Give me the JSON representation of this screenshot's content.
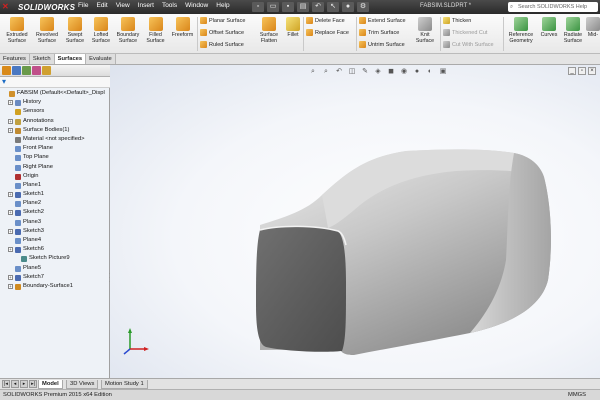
{
  "app": {
    "logo_text": "SOLIDWORKS",
    "menus": [
      "File",
      "Edit",
      "View",
      "Insert",
      "Tools",
      "Window",
      "Help"
    ],
    "document_title": "FABSIM.SLDPRT *",
    "help_search_placeholder": "Search SOLIDWORKS Help"
  },
  "ribbon": {
    "big_buttons": [
      {
        "label_l1": "Extruded",
        "label_l2": "Surface",
        "icon": "extruded-surface-icon"
      },
      {
        "label_l1": "Revolved",
        "label_l2": "Surface",
        "icon": "revolved-surface-icon"
      },
      {
        "label_l1": "Swept",
        "label_l2": "Surface",
        "icon": "swept-surface-icon"
      },
      {
        "label_l1": "Lofted",
        "label_l2": "Surface",
        "icon": "lofted-surface-icon"
      },
      {
        "label_l1": "Boundary",
        "label_l2": "Surface",
        "icon": "boundary-surface-icon"
      },
      {
        "label_l1": "Filled",
        "label_l2": "Surface",
        "icon": "filled-surface-icon"
      },
      {
        "label_l1": "Freeform",
        "label_l2": "",
        "icon": "freeform-icon"
      }
    ],
    "group1": [
      "Planar Surface",
      "Offset Surface",
      "Ruled Surface"
    ],
    "surface_flatten": {
      "label_l1": "Surface",
      "label_l2": "Flatten"
    },
    "fillet": "Fillet",
    "group2": [
      "Delete Face",
      "Replace Face"
    ],
    "group3": [
      "Extend Surface",
      "Trim Surface",
      "Untrim Surface"
    ],
    "knit": {
      "label_l1": "Knit",
      "label_l2": "Surface"
    },
    "group4": [
      "Thicken",
      "Thickened Cut",
      "Cut With Surface"
    ],
    "reference_geometry": {
      "label_l1": "Reference",
      "label_l2": "Geometry"
    },
    "curves": "Curves",
    "radiate": {
      "label_l1": "Radiate",
      "label_l2": "Surface"
    },
    "mid": "Mid-"
  },
  "command_tabs": [
    {
      "label": "Features",
      "active": false
    },
    {
      "label": "Sketch",
      "active": false
    },
    {
      "label": "Surfaces",
      "active": true
    },
    {
      "label": "Evaluate",
      "active": false
    }
  ],
  "feature_tree": [
    {
      "label": "FABSIM  (Default<<Default>_Displ",
      "indent": 0,
      "icon": "part-icon",
      "exp": false
    },
    {
      "label": "History",
      "indent": 1,
      "icon": "history-icon",
      "exp": true
    },
    {
      "label": "Sensors",
      "indent": 1,
      "icon": "sensors-icon",
      "exp": false
    },
    {
      "label": "Annotations",
      "indent": 1,
      "icon": "annotations-icon",
      "exp": true
    },
    {
      "label": "Surface Bodies(1)",
      "indent": 1,
      "icon": "surface-bodies-icon",
      "exp": true
    },
    {
      "label": "Material <not specified>",
      "indent": 1,
      "icon": "material-icon",
      "exp": false
    },
    {
      "label": "Front Plane",
      "indent": 1,
      "icon": "plane-icon",
      "exp": false
    },
    {
      "label": "Top Plane",
      "indent": 1,
      "icon": "plane-icon",
      "exp": false
    },
    {
      "label": "Right Plane",
      "indent": 1,
      "icon": "plane-icon",
      "exp": false
    },
    {
      "label": "Origin",
      "indent": 1,
      "icon": "origin-icon",
      "exp": false
    },
    {
      "label": "Plane1",
      "indent": 1,
      "icon": "plane-icon",
      "exp": false
    },
    {
      "label": "Sketch1",
      "indent": 1,
      "icon": "sketch-icon",
      "exp": true
    },
    {
      "label": "Plane2",
      "indent": 1,
      "icon": "plane-icon",
      "exp": false
    },
    {
      "label": "Sketch2",
      "indent": 1,
      "icon": "sketch-icon",
      "exp": true
    },
    {
      "label": "Plane3",
      "indent": 1,
      "icon": "plane-icon",
      "exp": false
    },
    {
      "label": "Sketch3",
      "indent": 1,
      "icon": "sketch-icon",
      "exp": true
    },
    {
      "label": "Plane4",
      "indent": 1,
      "icon": "plane-icon",
      "exp": false
    },
    {
      "label": "Sketch6",
      "indent": 1,
      "icon": "sketch-icon",
      "exp": true
    },
    {
      "label": "Sketch Picture9",
      "indent": 2,
      "icon": "sketch-picture-icon",
      "exp": false
    },
    {
      "label": "Plane5",
      "indent": 1,
      "icon": "plane-icon",
      "exp": false
    },
    {
      "label": "Sketch7",
      "indent": 1,
      "icon": "sketch-icon",
      "exp": true
    },
    {
      "label": "Boundary-Surface1",
      "indent": 1,
      "icon": "boundary-surface-icon",
      "exp": true
    }
  ],
  "model_tabs": [
    {
      "label": "Model",
      "active": true
    },
    {
      "label": "3D Views",
      "active": false
    },
    {
      "label": "Motion Study 1",
      "active": false
    }
  ],
  "status": {
    "edition": "SOLIDWORKS Premium 2015 x64 Edition",
    "units": "MMGS"
  },
  "colors": {
    "title_bar": "#333333",
    "active_tab": "#ffffff",
    "tree_bg": "#eef2f7",
    "model_surface": "#8a8a8a"
  }
}
